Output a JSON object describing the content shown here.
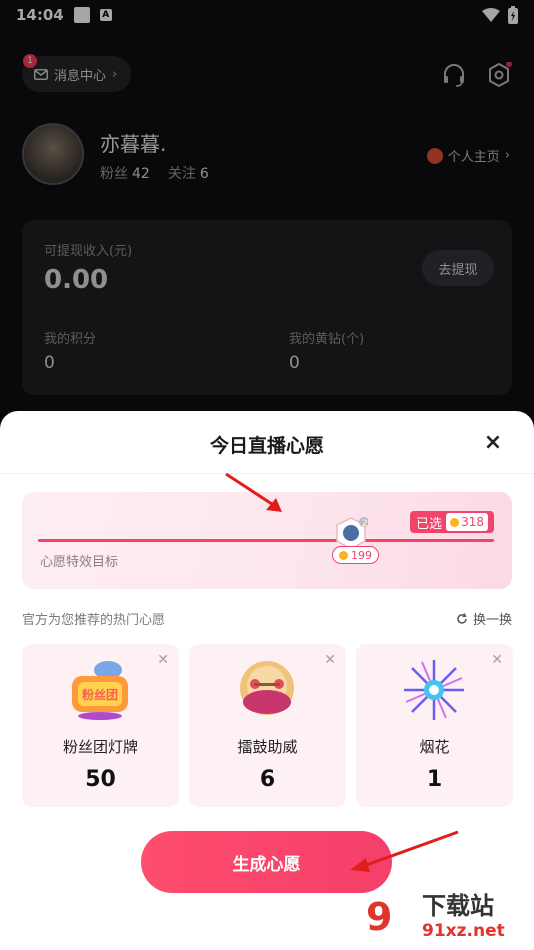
{
  "status_bar": {
    "time": "14:04",
    "a_icon_label": "A"
  },
  "profile": {
    "message_center": {
      "label": "消息中心",
      "badge": "1"
    },
    "username": "亦暮暮.",
    "fans_label": "粉丝",
    "fans_value": "42",
    "follow_label": "关注",
    "follow_value": "6",
    "homepage_label": "个人主页"
  },
  "wallet": {
    "income_label": "可提现收入(元)",
    "income_value": "0.00",
    "withdraw_label": "去提现",
    "points_label": "我的积分",
    "points_value": "0",
    "yellow_diamond_label": "我的黄钻(个)",
    "yellow_diamond_value": "0"
  },
  "sheet": {
    "title": "今日直播心愿",
    "close": "×",
    "goal": {
      "label": "心愿特效目标",
      "selected_label": "已选",
      "selected_value": "318",
      "marker_value": "199",
      "marker_badge": "2"
    },
    "recommend_label": "官方为您推荐的热门心愿",
    "refresh_label": "换一换",
    "wishes": [
      {
        "name": "粉丝团灯牌",
        "count": "50",
        "icon": "fan-club-light-sign-icon",
        "gift_text": "粉丝团"
      },
      {
        "name": "擂鼓助威",
        "count": "6",
        "icon": "drum-icon"
      },
      {
        "name": "烟花",
        "count": "1",
        "icon": "fireworks-icon"
      }
    ],
    "create_label": "生成心愿"
  },
  "watermark": {
    "text": "下载站",
    "domain": "91xz.net"
  },
  "colors": {
    "accent": "#f2436b",
    "sheet_bg": "#ffffff",
    "page_bg": "#0f0f11"
  }
}
